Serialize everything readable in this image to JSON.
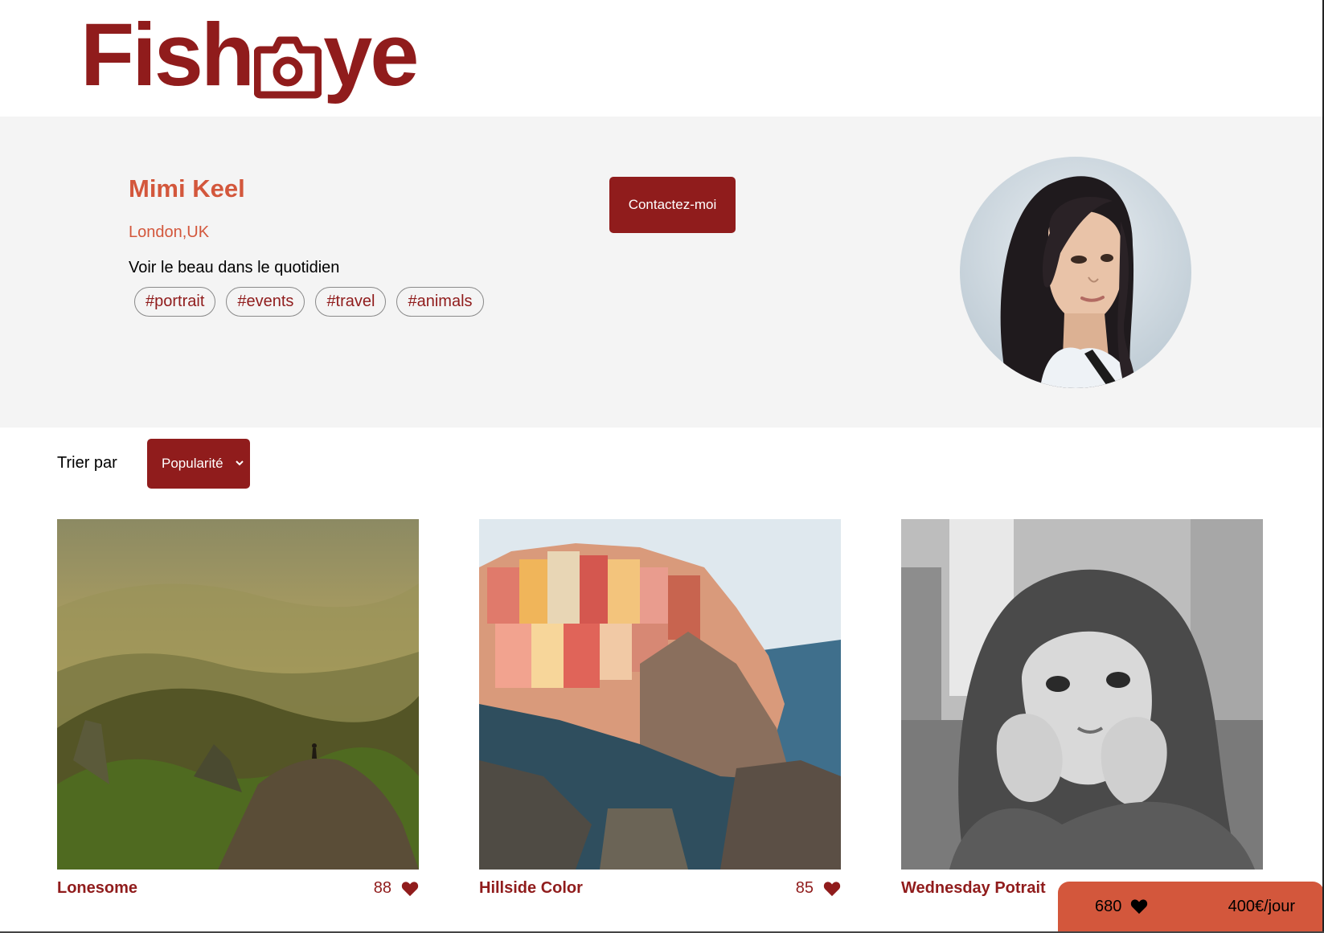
{
  "header": {
    "logo_text_left": "Fish",
    "logo_text_right": "ye",
    "brand_color": "#901C1C"
  },
  "photographer": {
    "name": "Mimi Keel",
    "location": "London,UK",
    "tagline": "Voir le beau dans le quotidien",
    "tags": [
      "#portrait",
      "#events",
      "#travel",
      "#animals"
    ],
    "contact_label": "Contactez-moi"
  },
  "sort": {
    "label": "Trier par",
    "selected": "Popularité"
  },
  "media": [
    {
      "title": "Lonesome",
      "likes": "88"
    },
    {
      "title": "Hillside Color",
      "likes": "85"
    },
    {
      "title": "Wednesday Potrait",
      "likes": ""
    }
  ],
  "stats": {
    "total_likes": "680",
    "price": "400€/jour"
  },
  "colors": {
    "primary": "#901C1C",
    "accent": "#D3573C",
    "banner_bg": "#F4F4F4"
  }
}
